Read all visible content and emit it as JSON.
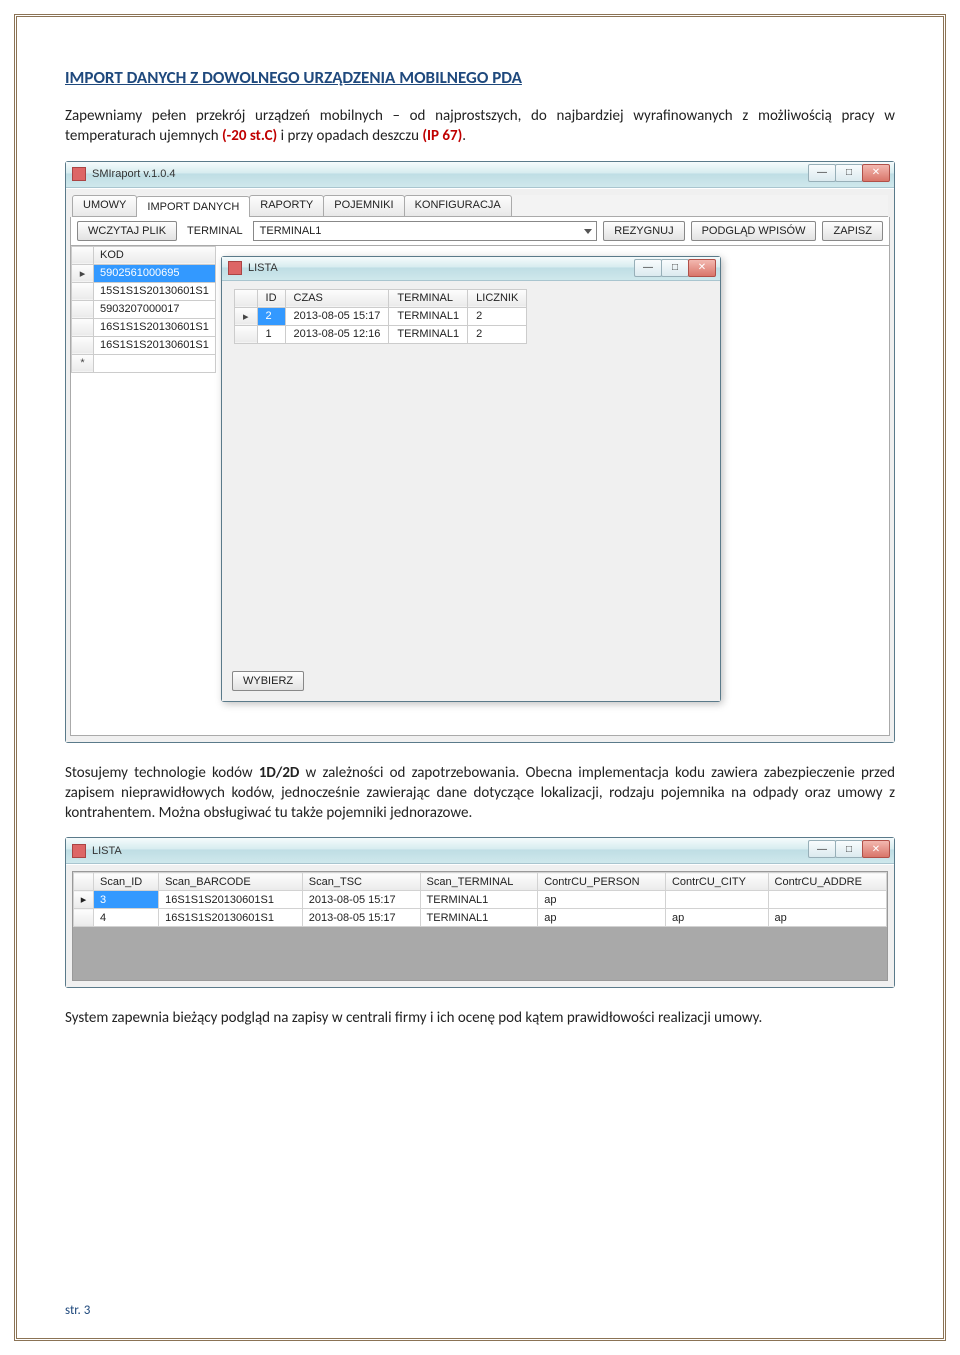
{
  "doc": {
    "heading": "IMPORT DANYCH Z DOWOLNEGO URZĄDZENIA MOBILNEGO PDA",
    "para1_a": "Zapewniamy pełen przekrój urządzeń mobilnych – od najprostszych, do najbardziej wyrafinowanych z możliwością pracy w temperaturach ujemnych ",
    "para1_red1": "(-20 st.C)",
    "para1_b": " i przy opadach deszczu ",
    "para1_red2": "(IP 67)",
    "para1_c": ".",
    "para2_a": "Stosujemy technologie kodów ",
    "para2_bold": "1D/2D",
    "para2_b": " w zależności od zapotrzebowania. Obecna implementacja kodu zawiera zabezpieczenie przed zapisem nieprawidłowych kodów, jednocześnie zawierając dane dotyczące lokalizacji, rodzaju pojemnika na odpady oraz umowy z kontrahentem. Można obsługiwać tu także pojemniki jednorazowe.",
    "para3": "System zapewnia bieżący podgląd na zapisy w centrali firmy i ich ocenę pod kątem prawidłowości realizacji umowy.",
    "footer": "str. 3"
  },
  "app": {
    "title": "SMIraport v.1.0.4",
    "tabs": [
      "UMOWY",
      "IMPORT DANYCH",
      "RAPORTY",
      "POJEMNIKI",
      "KONFIGURACJA"
    ],
    "activeTab": 1,
    "toolbar": {
      "load": "WCZYTAJ PLIK",
      "terminal_lbl": "TERMINAL",
      "terminal_val": "TERMINAL1",
      "cancel": "REZYGNUJ",
      "preview": "PODGLĄD WPISÓW",
      "save": "ZAPISZ"
    },
    "grid": {
      "header": "KOD",
      "rows": [
        "5902561000695",
        "15S1S1S20130601S1",
        "5903207000017",
        "16S1S1S20130601S1",
        "16S1S1S20130601S1"
      ]
    },
    "modal": {
      "title": "LISTA",
      "headers": [
        "ID",
        "CZAS",
        "TERMINAL",
        "LICZNIK"
      ],
      "rows": [
        {
          "id": "2",
          "czas": "2013-08-05 15:17",
          "term": "TERMINAL1",
          "lic": "2",
          "sel": true
        },
        {
          "id": "1",
          "czas": "2013-08-05 12:16",
          "term": "TERMINAL1",
          "lic": "2",
          "sel": false
        }
      ],
      "select_btn": "WYBIERZ"
    }
  },
  "app2": {
    "title": "LISTA",
    "headers": [
      "Scan_ID",
      "Scan_BARCODE",
      "Scan_TSC",
      "Scan_TERMINAL",
      "ContrCU_PERSON",
      "ContrCU_CITY",
      "ContrCU_ADDRE"
    ],
    "rows": [
      {
        "c": [
          "3",
          "16S1S1S20130601S1",
          "2013-08-05 15:17",
          "TERMINAL1",
          "ap",
          "",
          ""
        ],
        "sel": true
      },
      {
        "c": [
          "4",
          "16S1S1S20130601S1",
          "2013-08-05 15:17",
          "TERMINAL1",
          "ap",
          "ap",
          "ap"
        ],
        "sel": false
      }
    ]
  }
}
